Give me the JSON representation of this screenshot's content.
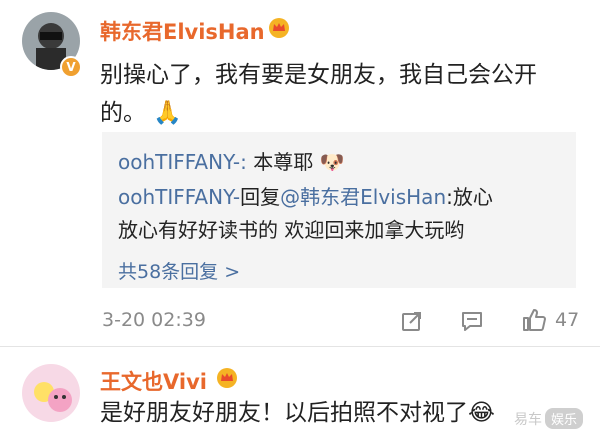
{
  "comment1": {
    "username": "韩东君ElvisHan",
    "body_line1": "别操心了，我有要是女朋友，我自己会公开",
    "body_line2": "的。",
    "body_emoji": "🙏",
    "replies": [
      {
        "author": "oohTIFFANY-:",
        "text": " 本尊耶",
        "emoji": "🐶"
      },
      {
        "author": "oohTIFFANY-",
        "text_mid": "回复",
        "mention": "@韩东君ElvisHan",
        "text_line1": ":放心",
        "text_line2": "放心有好好读书的 欢迎回来加拿大玩哟"
      }
    ],
    "more_replies": "共58条回复 >",
    "timestamp": "3-20 02:39",
    "like_count": "47"
  },
  "comment2": {
    "username": "王文也Vivi",
    "body_line1": "是好朋友好朋友！以后拍照不对视了",
    "body_emoji": "😂"
  },
  "watermark": {
    "text": "易车",
    "box": "娱乐"
  },
  "colors": {
    "username": "#e8682c",
    "link": "#4a6fa0",
    "verified": "#f0a030",
    "muted": "#8a8a8a"
  },
  "icons": {
    "verified": "verified-v-icon",
    "crown": "crown-icon",
    "share": "share-icon",
    "comment": "comment-icon",
    "like": "thumbs-up-icon"
  }
}
